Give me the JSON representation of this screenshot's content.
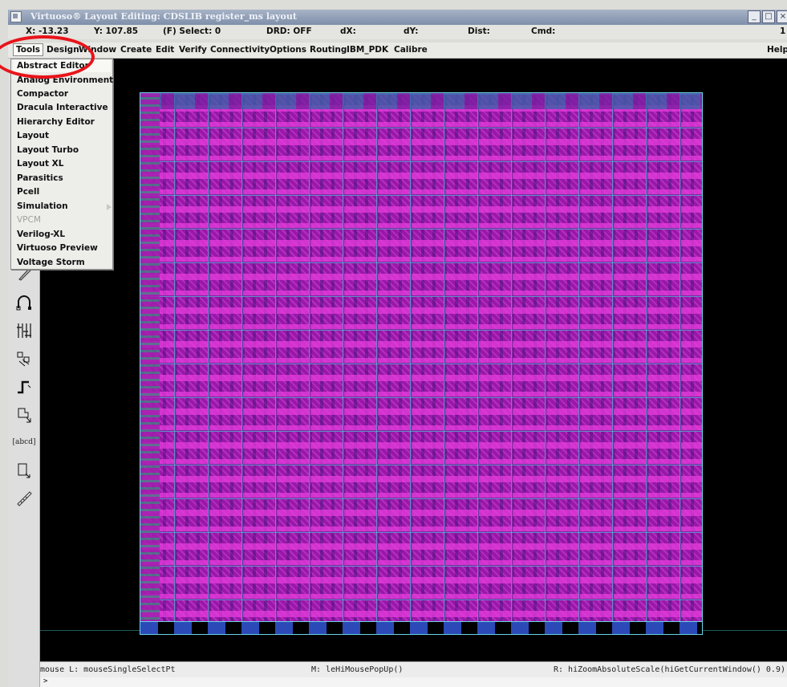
{
  "window": {
    "title": "Virtuoso® Layout Editing: CDSLIB register_ms layout",
    "buttons": [
      "_",
      "□",
      "×"
    ]
  },
  "status": {
    "x": "X: -13.23",
    "y": "Y: 107.85",
    "select": "(F) Select: 0",
    "drd": "DRD: OFF",
    "dx": "dX:",
    "dy": "dY:",
    "dist": "Dist:",
    "cmd": "Cmd:",
    "trailing": "1"
  },
  "menubar": {
    "items": [
      "Tools",
      "Design",
      "Window",
      "Create",
      "Edit",
      "Verify",
      "Connectivity",
      "Options",
      "Routing",
      "IBM_PDK",
      "Calibre"
    ],
    "help": "Help"
  },
  "tools_menu": {
    "items": [
      {
        "label": "Abstract Editor",
        "enabled": true,
        "highlighted": true
      },
      {
        "label": "Analog Environment",
        "enabled": true
      },
      {
        "label": "Compactor",
        "enabled": true
      },
      {
        "label": "Dracula Interactive",
        "enabled": true
      },
      {
        "label": "Hierarchy Editor",
        "enabled": true
      },
      {
        "label": "Layout",
        "enabled": true
      },
      {
        "label": "Layout Turbo",
        "enabled": true
      },
      {
        "label": "Layout XL",
        "enabled": true
      },
      {
        "label": "Parasitics",
        "enabled": true
      },
      {
        "label": "Pcell",
        "enabled": true
      },
      {
        "label": "Simulation",
        "enabled": true,
        "submenu": true
      },
      {
        "label": "VPCM",
        "enabled": false
      },
      {
        "label": "Verilog-XL",
        "enabled": true
      },
      {
        "label": "Virtuoso Preview",
        "enabled": true
      },
      {
        "label": "Voltage Storm",
        "enabled": true
      }
    ]
  },
  "toolbar": {
    "icons": [
      "ruler-pencil-icon",
      "undo-arc-icon",
      "grid-array-icon",
      "move-icon",
      "path-icon",
      "stretch-icon",
      "label-icon",
      "select-rect-icon",
      "measure-ruler-icon"
    ],
    "label_text": "[abcd]"
  },
  "bottom": {
    "mouse_l": "mouse L: mouseSingleSelectPt",
    "mouse_m": "M: leHiMousePopUp()",
    "mouse_r": "R: hiZoomAbsoluteScale(hiGetCurrentWindow() 0.9)",
    "prompt": ">"
  },
  "annotation": {
    "color": "#e8141a"
  }
}
